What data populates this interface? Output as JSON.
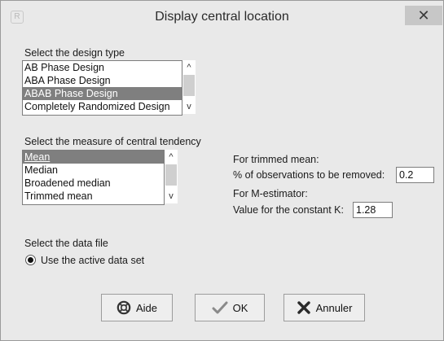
{
  "window": {
    "title": "Display central location",
    "close_glyph": "✕",
    "app_icon_glyph": "R"
  },
  "design": {
    "label": "Select the design type",
    "items": [
      "AB Phase Design",
      "ABA Phase Design",
      "ABAB Phase Design",
      "Completely Randomized Design"
    ],
    "selected": "ABAB Phase Design"
  },
  "measure": {
    "label": "Select the measure of central tendency",
    "items": [
      "Mean",
      "Median",
      "Broadened median",
      "Trimmed mean"
    ],
    "selected": "Mean"
  },
  "trimmed": {
    "heading": "For trimmed mean:",
    "field_label": "% of observations to be removed:",
    "value": "0.2"
  },
  "mestimator": {
    "heading": "For M-estimator:",
    "field_label": "Value for the constant K:",
    "value": "1.28"
  },
  "datafile": {
    "label": "Select the data file",
    "option": "Use the active data set"
  },
  "buttons": {
    "help": "Aide",
    "ok": "OK",
    "cancel": "Annuler"
  },
  "scroll_glyphs": {
    "up": "^",
    "down": "v"
  },
  "icons": {
    "help": "lifebuoy-icon",
    "ok": "checkmark-icon",
    "cancel": "x-icon"
  },
  "colors": {
    "selection": "#7f7f7f",
    "window_bg": "#e9e9e9"
  }
}
